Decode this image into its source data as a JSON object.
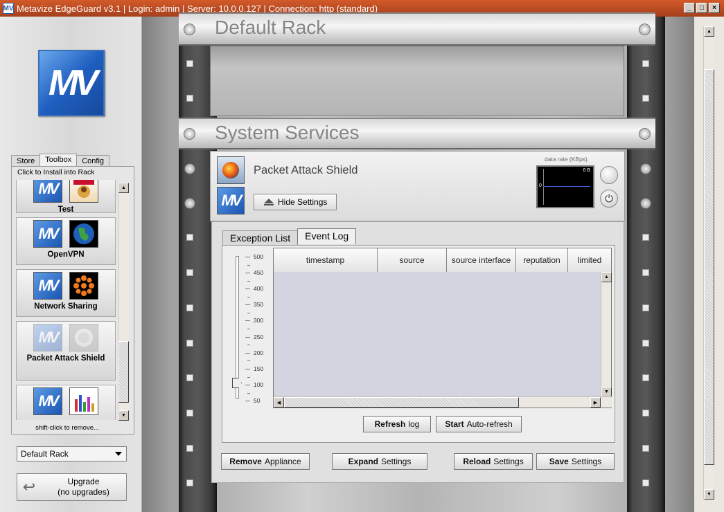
{
  "window": {
    "icon_text": "MV",
    "title": "Metavize EdgeGuard v3.1  |  Login: admin  |  Server: 10.0.0.127  |  Connection: http (standard)",
    "minimize": "_",
    "maximize": "□",
    "close": "×"
  },
  "sidebar": {
    "logo_text": "MV",
    "tabs": [
      "Store",
      "Toolbox",
      "Config"
    ],
    "hint": "Click to Install into Rack",
    "footer": "shift-click to remove...",
    "items": [
      {
        "label": "Test"
      },
      {
        "label": "OpenVPN"
      },
      {
        "label": "Network Sharing"
      },
      {
        "label": "Packet Attack Shield"
      },
      {
        "label": ""
      }
    ],
    "rack_select": "Default Rack",
    "upgrade_line1": "Upgrade",
    "upgrade_line2": "(no upgrades)"
  },
  "rack": {
    "default_title": "Default Rack",
    "services_title": "System Services"
  },
  "appliance": {
    "name": "Packet Attack Shield",
    "hide_settings": "Hide Settings",
    "rate_label": "data rate (KBps)",
    "rate_value": "0 B",
    "rate_zero": "0",
    "power_icon": "⏻",
    "tabs": [
      "Exception List",
      "Event Log"
    ],
    "slider_ticks": [
      "500",
      "450",
      "400",
      "350",
      "300",
      "250",
      "200",
      "150",
      "100",
      "50"
    ],
    "slider_value": 100,
    "columns": [
      "timestamp",
      "source",
      "source interface",
      "reputation",
      "limited"
    ],
    "refresh_bold": "Refresh",
    "refresh_rest": "log",
    "auto_bold": "Start",
    "auto_rest": "Auto-refresh",
    "buttons": {
      "remove_bold": "Remove",
      "remove_rest": "Appliance",
      "expand_bold": "Expand",
      "expand_rest": "Settings",
      "reload_bold": "Reload",
      "reload_rest": "Settings",
      "save_bold": "Save",
      "save_rest": "Settings"
    }
  },
  "icons": {
    "up_arrow": "▲",
    "down_arrow": "▼",
    "left_arrow": "◀",
    "right_arrow": "▶",
    "upgrade": "↩"
  }
}
